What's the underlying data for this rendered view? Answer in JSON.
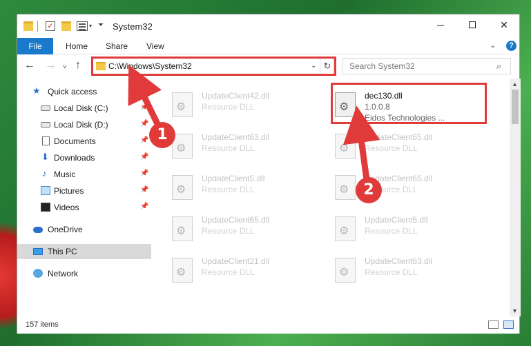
{
  "window": {
    "title": "System32",
    "controls": {
      "minimize": "",
      "maximize": "",
      "close": "✕"
    }
  },
  "quick_access_toolbar": {
    "check_glyph": "✓",
    "arrow": "▾",
    "customize": "⏷"
  },
  "ribbon": {
    "tabs": [
      {
        "label": "File",
        "active": true
      },
      {
        "label": "Home"
      },
      {
        "label": "Share"
      },
      {
        "label": "View"
      }
    ],
    "expand_glyph": "⌄",
    "help_glyph": "?"
  },
  "address_bar": {
    "path": "C:\\Windows\\System32",
    "back_glyph": "←",
    "forward_glyph": "→",
    "recent_glyph": "˅",
    "up_glyph": "↑",
    "dropdown_glyph": "⌄",
    "refresh_glyph": "↻"
  },
  "search": {
    "placeholder": "Search System32",
    "icon_glyph": "⌕"
  },
  "nav_pane": {
    "items": [
      {
        "label": "Quick access",
        "icon": "star-icon",
        "glyph": "★"
      },
      {
        "label": "Local Disk (C:)",
        "icon": "drive-icon",
        "pinned": true
      },
      {
        "label": "Local Disk (D:)",
        "icon": "drive-icon",
        "pinned": true
      },
      {
        "label": "Documents",
        "icon": "documents-icon",
        "pinned": true
      },
      {
        "label": "Downloads",
        "icon": "download-icon",
        "glyph": "⬇",
        "pinned": true
      },
      {
        "label": "Music",
        "icon": "music-icon",
        "glyph": "♪",
        "pinned": true
      },
      {
        "label": "Pictures",
        "icon": "pictures-icon",
        "pinned": true
      },
      {
        "label": "Videos",
        "icon": "videos-icon",
        "pinned": true
      },
      {
        "label": "OneDrive",
        "icon": "onedrive-icon"
      },
      {
        "label": "This PC",
        "icon": "pc-icon",
        "selected": true
      },
      {
        "label": "Network",
        "icon": "network-icon"
      }
    ],
    "pin_glyph": "📌"
  },
  "files": [
    {
      "name": "UpdateClient42.dll",
      "type": "Resource DLL"
    },
    {
      "name": "dec130.dll",
      "type": "1.0.0.8",
      "publisher": "Eidos Technologies ...",
      "highlighted": true
    },
    {
      "name": "UpdateClient63.dll",
      "type": "Resource DLL"
    },
    {
      "name": "UpdateClient65.dll",
      "type": "Resource DLL"
    },
    {
      "name": "UpdateClient5.dll",
      "type": "Resource DLL"
    },
    {
      "name": "UpdateClient65.dll",
      "type": "Resource DLL"
    },
    {
      "name": "UpdateClient65.dll",
      "type": "Resource DLL"
    },
    {
      "name": "UpdateClient5.dll",
      "type": "Resource DLL"
    },
    {
      "name": "UpdateClient21.dll",
      "type": "Resource DLL"
    },
    {
      "name": "UpdateClient63.dll",
      "type": "Resource DLL"
    }
  ],
  "scrollbar": {
    "up_glyph": "▲",
    "down_glyph": "▼"
  },
  "status_bar": {
    "item_count": "157 items"
  },
  "annotations": {
    "step1": "1",
    "step2": "2"
  },
  "colors": {
    "accent": "#1979ca",
    "annotation_red": "#e03a3a",
    "selection": "#d9d9d9"
  }
}
